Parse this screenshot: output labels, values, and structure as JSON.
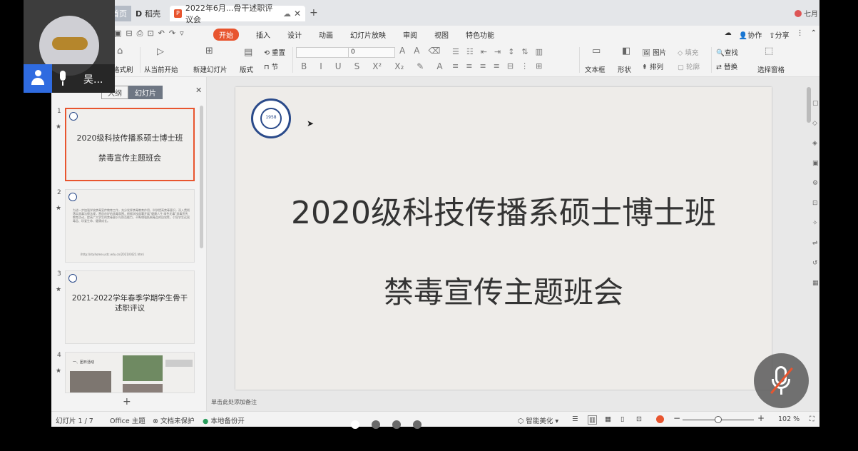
{
  "titlebar": {
    "home_tab": "首页",
    "daoke_tab": "稻壳",
    "doc_tab": "2022年6月...骨干述职评议会",
    "user": "七月"
  },
  "menu": {
    "items": [
      "开始",
      "插入",
      "设计",
      "动画",
      "幻灯片放映",
      "审阅",
      "视图",
      "特色功能"
    ],
    "right": [
      "协作",
      "分享"
    ]
  },
  "ribbon": {
    "format_painter": "格式刷",
    "from_current": "从当前开始",
    "new_slide": "新建幻灯片",
    "layout": "版式",
    "reset": "重置",
    "section": "节",
    "font_size": "0",
    "textbox": "文本框",
    "shape": "形状",
    "picture": "图片",
    "fill": "填充",
    "arrange": "排列",
    "outline": "轮廓",
    "find": "查找",
    "replace": "替换",
    "select_pane": "选择窗格"
  },
  "leftpanel": {
    "tabs": [
      "大纲",
      "幻灯片"
    ],
    "slides": [
      {
        "num": "1",
        "title_line1": "2020级科技传播系硕士博士班",
        "title_line2": "禁毒宣传主题班会"
      },
      {
        "num": "2",
        "body": "为进一步加强学校禁毒宣传教育工作，充分发挥禁毒教育作用，科学提高禁毒意识，深入贯彻落实禁毒法律法规，营造良好的禁毒氛围，根据学校部署开展“健康人生 绿色无毒”禁毒宣传教育活动，提高广大学生的禁毒意识与防范能力，不断增强抵制毒品的自觉性，引导学生远离毒品、珍爱生命、健康成长。",
        "url": "（http://stuhome.ustc.edu.cn/2021/0421.htm）"
      },
      {
        "num": "3",
        "title_line1": "2021-2022学年春季学期学生骨干",
        "title_line2": "述职评议"
      },
      {
        "num": "4",
        "heading": "一、团日活动"
      }
    ]
  },
  "slide": {
    "title": "2020级科技传播系硕士博士班",
    "subtitle": "禁毒宣传主题班会",
    "logo_year": "1958",
    "notes_hint": "单击此处添加备注"
  },
  "statusbar": {
    "slide_index": "幻灯片 1 / 7",
    "theme": "Office 主题",
    "protect": "文档未保护",
    "backup": "本地备份开",
    "beautify": "智能美化",
    "zoom": "102 %"
  },
  "video": {
    "participant_name": "吴..."
  },
  "colors": {
    "accent": "#e8552f",
    "call_blue": "#2f6be0"
  }
}
